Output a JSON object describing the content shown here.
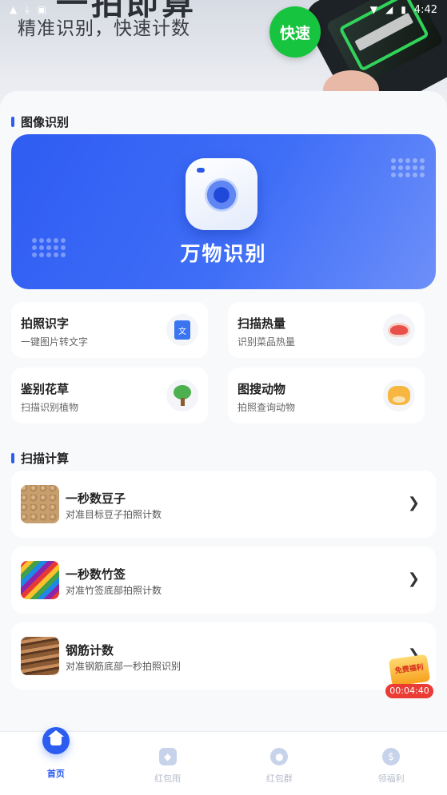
{
  "status_bar": {
    "time": "4:42"
  },
  "banner": {
    "title_partial": "一拍即算",
    "subtitle": "精准识别，快速计数",
    "badge": "快速"
  },
  "image_section": {
    "title": "图像识别",
    "hero_label": "万物识别",
    "features": [
      {
        "title": "拍照识字",
        "desc": "一键图片转文字",
        "icon": "document-text-icon",
        "icon_glyph": "文"
      },
      {
        "title": "扫描热量",
        "desc": "识别菜品热量",
        "icon": "meat-icon"
      },
      {
        "title": "鉴别花草",
        "desc": "扫描识别植物",
        "icon": "tree-icon"
      },
      {
        "title": "图搜动物",
        "desc": "拍照查询动物",
        "icon": "cow-icon"
      }
    ]
  },
  "count_section": {
    "title": "扫描计算",
    "items": [
      {
        "title": "一秒数豆子",
        "desc": "对准目标豆子拍照计数"
      },
      {
        "title": "一秒数竹签",
        "desc": "对准竹签底部拍照计数"
      },
      {
        "title": "钢筋计数",
        "desc": "对准钢筋底部一秒拍照识别"
      }
    ],
    "chevron": "❯"
  },
  "reward": {
    "text": "免费福利",
    "timer": "00:04:40"
  },
  "bottom_nav": [
    {
      "label": "首页",
      "active": true
    },
    {
      "label": "红包雨",
      "active": false
    },
    {
      "label": "红包群",
      "active": false
    },
    {
      "label": "领福利",
      "active": false
    }
  ]
}
